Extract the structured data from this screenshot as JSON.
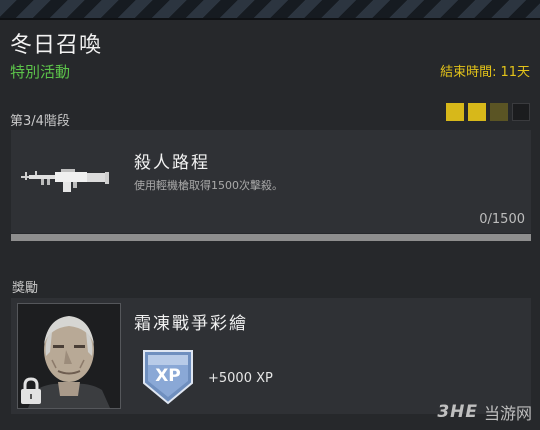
{
  "event": {
    "title": "冬日召喚",
    "subtitle": "特別活動",
    "end_label": "結束時間:",
    "end_value": "11天"
  },
  "stage": {
    "label": "第3/4階段",
    "pips": [
      "filled",
      "filled",
      "dim",
      "empty"
    ]
  },
  "challenge": {
    "weapon_icon": "light-machine-gun-icon",
    "title": "殺人路程",
    "description": "使用輕機槍取得1500次擊殺。",
    "progress_text": "0/1500",
    "progress_fraction": 0
  },
  "reward": {
    "section_label": "獎勵",
    "name": "霜凍戰爭彩繪",
    "portrait_icon": "soldier-portrait-icon",
    "lock_icon": "lock-icon",
    "badge_text": "XP",
    "xp_amount": "+5000 XP"
  },
  "watermark": {
    "logo": "3HE",
    "text": "当游网"
  },
  "colors": {
    "accent_yellow": "#e3c319",
    "event_green": "#5cc34a",
    "panel": "#2f3135",
    "background": "#26282b"
  }
}
